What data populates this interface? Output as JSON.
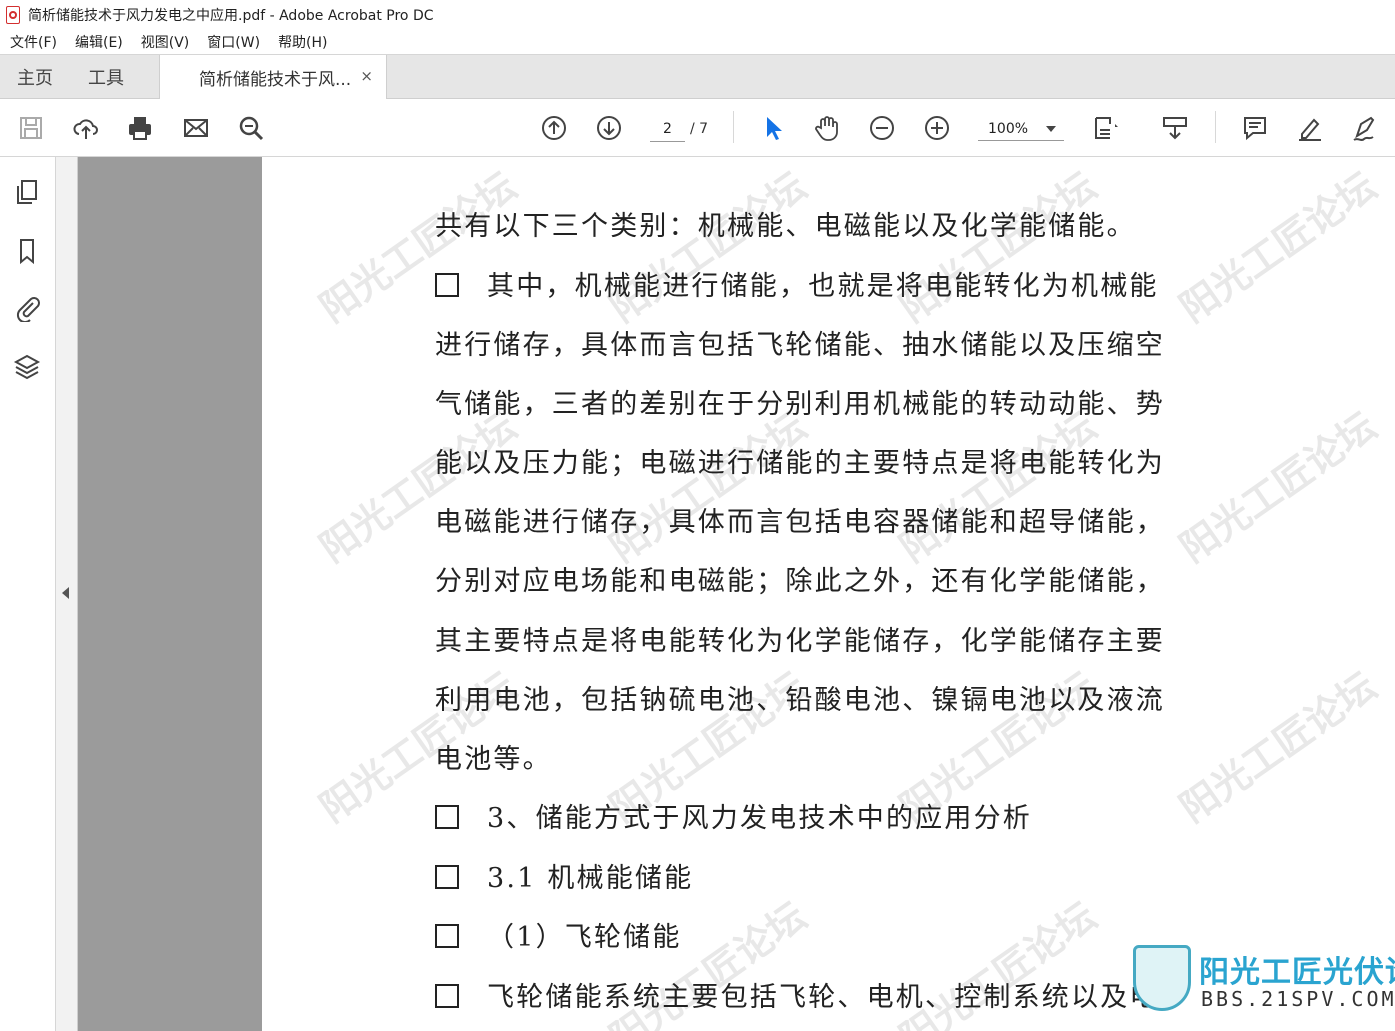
{
  "window": {
    "title": "简析储能技术于风力发电之中应用.pdf - Adobe Acrobat Pro DC"
  },
  "menu": [
    "文件(F)",
    "编辑(E)",
    "视图(V)",
    "窗口(W)",
    "帮助(H)"
  ],
  "tabs": {
    "home": "主页",
    "tools": "工具",
    "document": "简析储能技术于风...",
    "close": "×"
  },
  "toolbar": {
    "page_current": "2",
    "page_total": "/ 7",
    "zoom": "100%"
  },
  "icons": [
    "save-icon",
    "cloud-upload-icon",
    "print-icon",
    "mail-icon",
    "search-icon",
    "prev-page-icon",
    "next-page-icon",
    "select-cursor-icon",
    "hand-icon",
    "zoom-out-icon",
    "zoom-in-icon",
    "fit-page-icon",
    "scroll-mode-icon",
    "comment-icon",
    "highlight-icon",
    "sign-icon",
    "pages-icon",
    "bookmark-icon",
    "attachment-icon",
    "layers-icon"
  ],
  "document": {
    "lines": [
      "共有以下三个类别：机械能、电磁能以及化学能储能。",
      "其中，机械能进行储能，也就是将电能转化为机械能",
      "进行储存，具体而言包括飞轮储能、抽水储能以及压缩空",
      "气储能，三者的差别在于分别利用机械能的转动动能、势",
      "能以及压力能；电磁进行储能的主要特点是将电能转化为",
      "电磁能进行储存，具体而言包括电容器储能和超导储能，",
      "分别对应电场能和电磁能；除此之外，还有化学能储能，",
      "其主要特点是将电能转化为化学能储存，化学能储存主要",
      "利用电池，包括钠硫电池、铅酸电池、镍镉电池以及液流",
      "电池等。",
      "3、储能方式于风力发电技术中的应用分析",
      "3.1 机械能储能",
      "（1）飞轮储能",
      "飞轮储能系统主要包括飞轮、电机、控制系统以及电"
    ],
    "watermark": "阳光工匠论坛",
    "watermark_sub": "BBS.21SPV.COM",
    "logo_title": "阳光工匠光伏论坛",
    "logo_sub": "BBS.21SPV.COM"
  }
}
